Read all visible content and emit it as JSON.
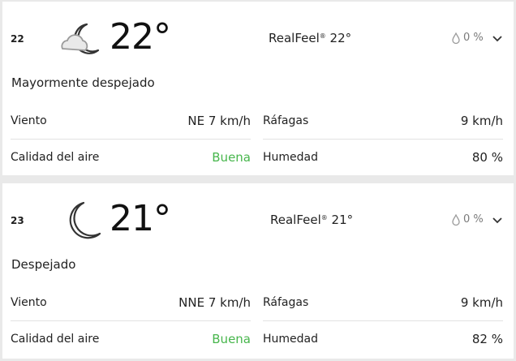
{
  "forecasts": [
    {
      "hour": "22",
      "icon": "moon-cloud-icon",
      "temp": "22°",
      "realfeel_label": "RealFeel",
      "realfeel_value": " 22°",
      "precip": "0 %",
      "phrase": "Mayormente despejado",
      "wind_label": "Viento",
      "wind_value": "NE 7 km/h",
      "gusts_label": "Ráfagas",
      "gusts_value": "9 km/h",
      "air_label": "Calidad del aire",
      "air_value": "Buena",
      "humidity_label": "Humedad",
      "humidity_value": "80 %"
    },
    {
      "hour": "23",
      "icon": "moon-icon",
      "temp": "21°",
      "realfeel_label": "RealFeel",
      "realfeel_value": " 21°",
      "precip": "0 %",
      "phrase": "Despejado",
      "wind_label": "Viento",
      "wind_value": "NNE 7 km/h",
      "gusts_label": "Ráfagas",
      "gusts_value": "9 km/h",
      "air_label": "Calidad del aire",
      "air_value": "Buena",
      "humidity_label": "Humedad",
      "humidity_value": "82 %"
    }
  ],
  "colors": {
    "good": "#47b64c",
    "muted": "#7a7a7a"
  }
}
